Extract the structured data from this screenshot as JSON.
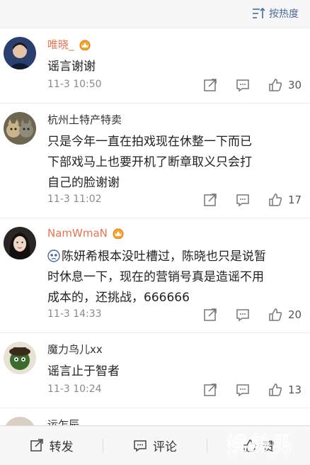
{
  "header": {
    "sort_label": "按热度",
    "sort_icon": "sort-lines-icon"
  },
  "comments": [
    {
      "username": "唯晓_",
      "vip": true,
      "badge_icon": "crown-icon",
      "text": "谣言谢谢",
      "time": "11-3 10:50",
      "likes": "30"
    },
    {
      "username": "杭州土特产特卖",
      "vip": false,
      "text_lines": [
        "只是今年一直在拍戏现在休整一下而已",
        "下部戏马上也要开机了断章取义只会打",
        "自己的脸谢谢"
      ],
      "time": "11-3 11:02",
      "likes": "17"
    },
    {
      "username": "NamWmaN",
      "vip": true,
      "badge_icon": "crown-icon",
      "emoji_icon": "sad-face-icon",
      "text_lines": [
        "陈妍希根本没吐槽过，陈晓也只是说暂",
        "时休息一下，现在的营销号真是造谣不用",
        "成本的，还挑战，666666"
      ],
      "time": "11-3 14:33",
      "likes": "20"
    },
    {
      "username": "魔力鸟儿xx",
      "vip": false,
      "text": "谣言止于智者",
      "time": "11-3 10:24",
      "likes": "13"
    },
    {
      "username": "运乍辰"
    }
  ],
  "bottom_bar": {
    "repost_label": "转发",
    "comment_label": "评论",
    "like_label": "赞"
  },
  "watermark": "娱美男",
  "colors": {
    "vip_name": "#eb7350",
    "link_blue": "#4a6a9a",
    "meta_gray": "#8a8a8a"
  }
}
